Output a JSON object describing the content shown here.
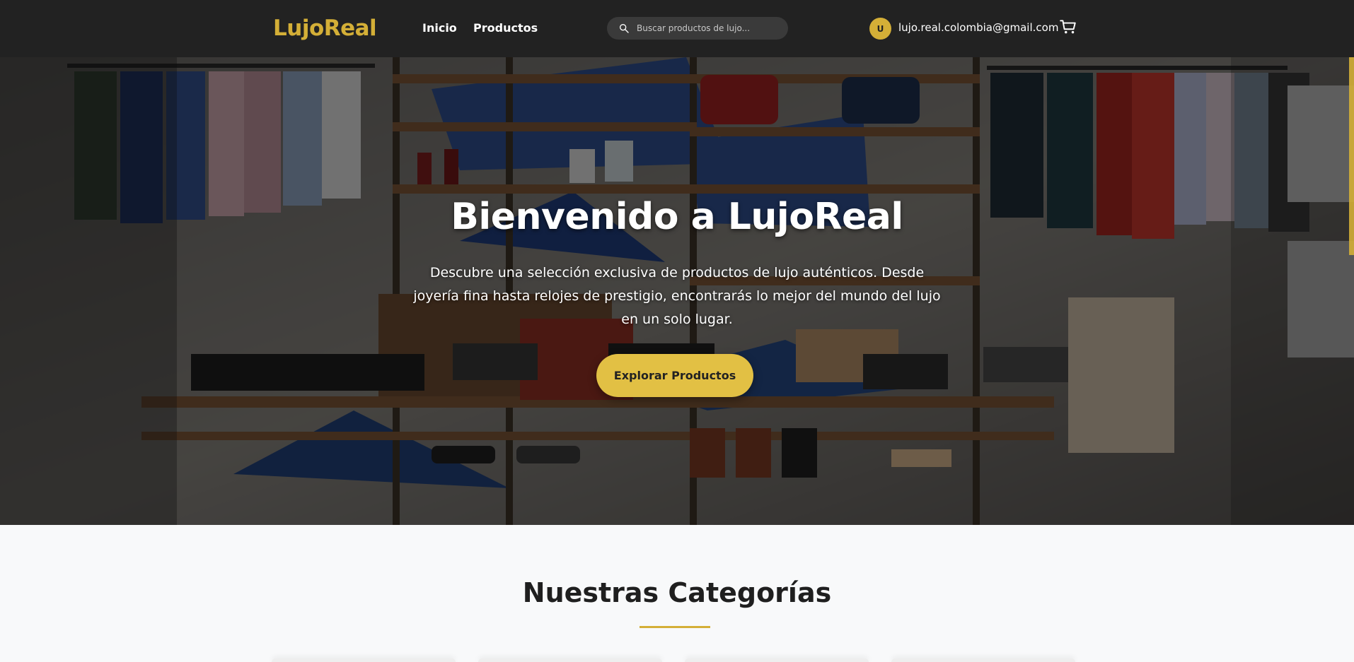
{
  "header": {
    "logo": "LujoReal",
    "nav": {
      "inicio": "Inicio",
      "productos": "Productos"
    },
    "search": {
      "placeholder": "Buscar productos de lujo..."
    },
    "user": {
      "avatar_initial": "U",
      "email": "lujo.real.colombia@gmail.com"
    },
    "icons": {
      "search": "search-icon",
      "cart": "shopping-cart-icon"
    }
  },
  "hero": {
    "title": "Bienvenido a LujoReal",
    "description": "Descubre una selección exclusiva de productos de lujo auténticos. Desde joyería fina hasta relojes de prestigio, encontrarás lo mejor del mundo del lujo en un solo lugar.",
    "button_label": "Explorar Productos"
  },
  "categories": {
    "title": "Nuestras Categorías"
  },
  "colors": {
    "brand_gold": "#d4af37",
    "button_gold": "#e2c044",
    "nav_background": "#222222"
  }
}
